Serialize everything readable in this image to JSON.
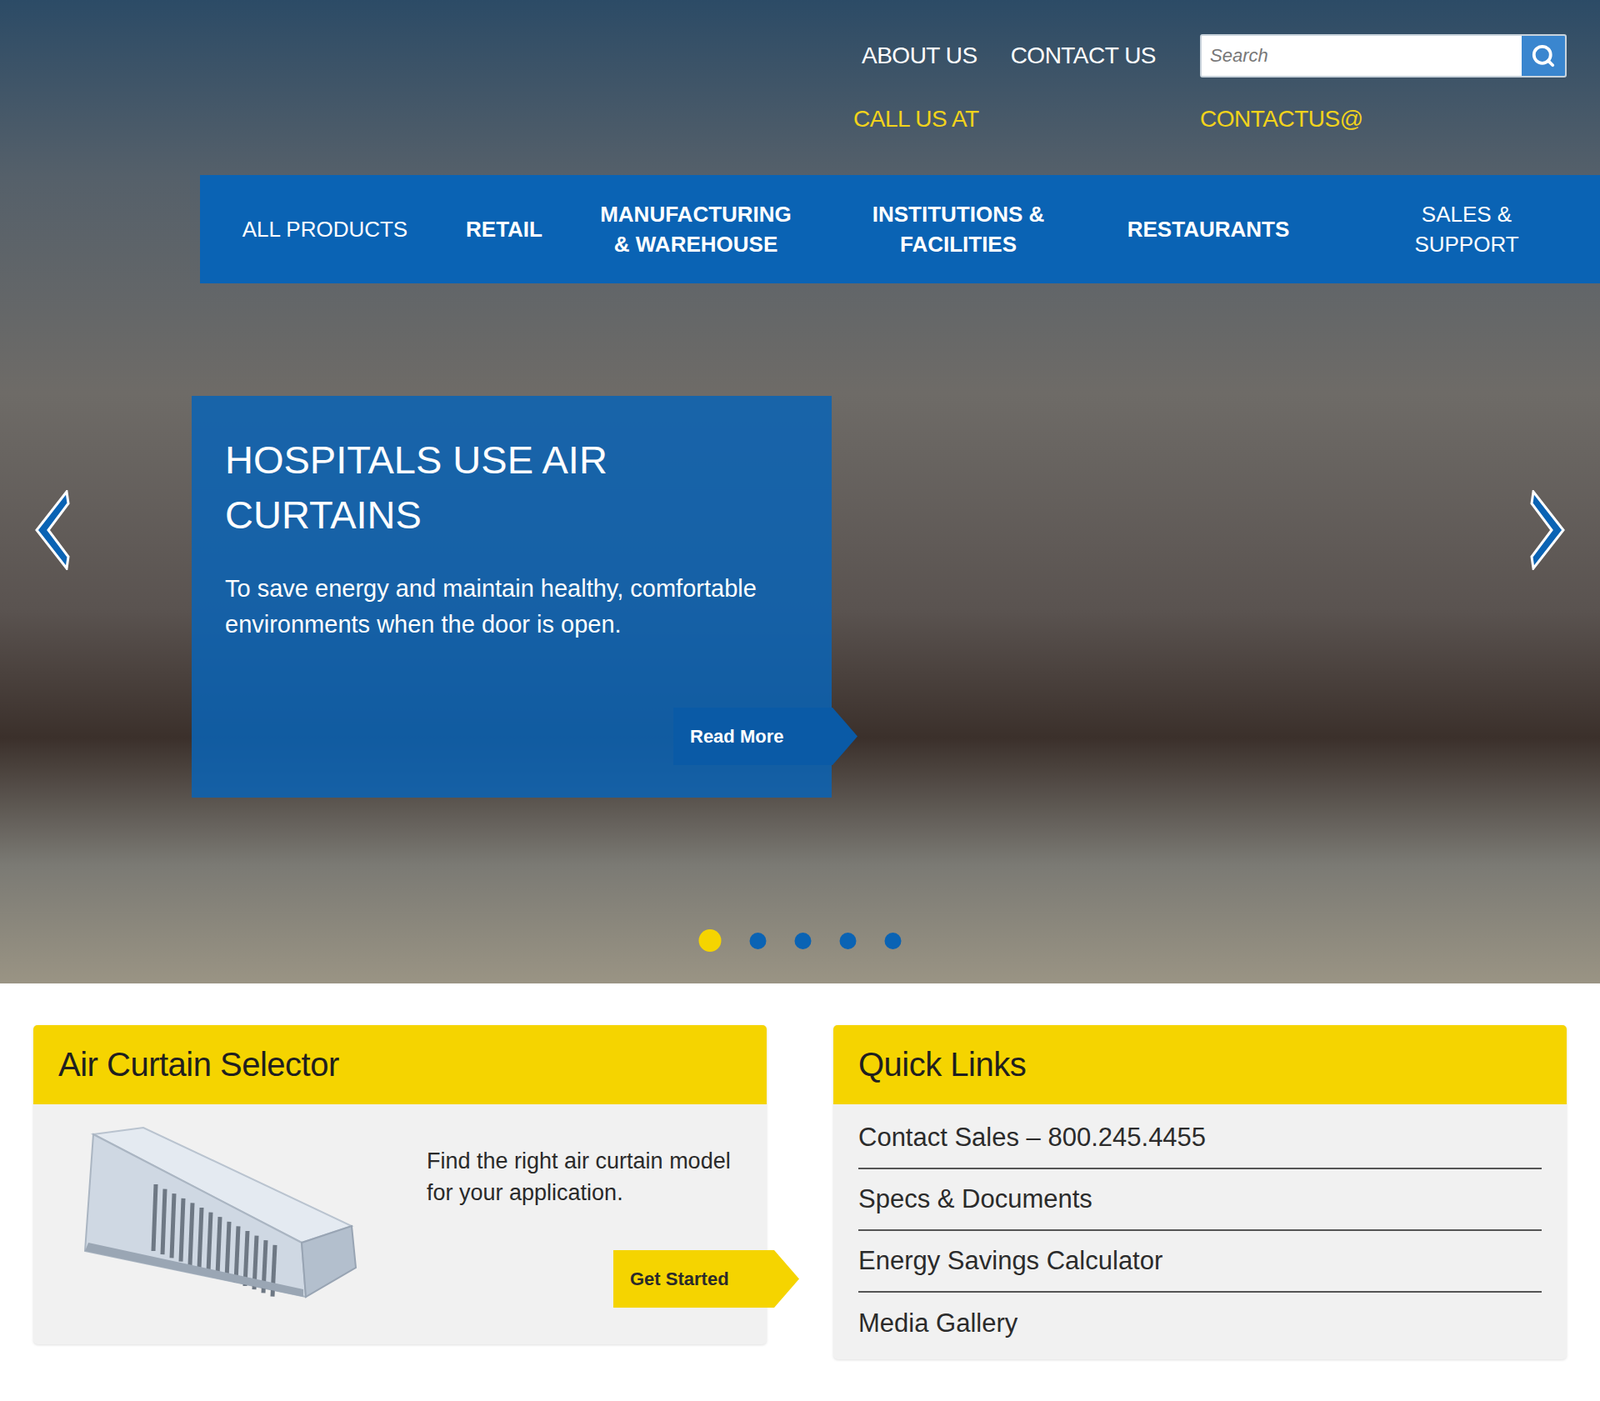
{
  "header": {
    "links": [
      {
        "label": "ABOUT US"
      },
      {
        "label": "CONTACT US"
      }
    ],
    "search": {
      "placeholder": "Search"
    },
    "contact": [
      "CALL US AT",
      "CONTACTUS@"
    ]
  },
  "nav": [
    {
      "label": "ALL PRODUCTS",
      "kind": "plain"
    },
    {
      "label": "RETAIL",
      "kind": "bold"
    },
    {
      "label": "MANUFACTURING & WAREHOUSE",
      "kind": "bold"
    },
    {
      "label": "INSTITUTIONS & FACILITIES",
      "kind": "bold"
    },
    {
      "label": "RESTAURANTS",
      "kind": "bold"
    },
    {
      "label": "SALES & SUPPORT",
      "kind": "plain"
    }
  ],
  "slide": {
    "title": "HOSPITALS USE AIR CURTAINS",
    "text": "To save energy and maintain healthy, comfortable environments when the door is open.",
    "button": "Read More"
  },
  "slider_dots": [
    {
      "selected": true
    },
    {
      "selected": false
    },
    {
      "selected": false
    },
    {
      "selected": false
    },
    {
      "selected": false
    }
  ],
  "selector": {
    "title": "Air Curtain Selector",
    "text": "Find the right air curtain model for your application.",
    "button": "Get Started"
  },
  "quick_links": {
    "title": "Quick Links",
    "items": [
      "Contact Sales – 800.245.4455",
      "Specs & Documents",
      "Energy Savings Calculator",
      "Media Gallery"
    ]
  }
}
